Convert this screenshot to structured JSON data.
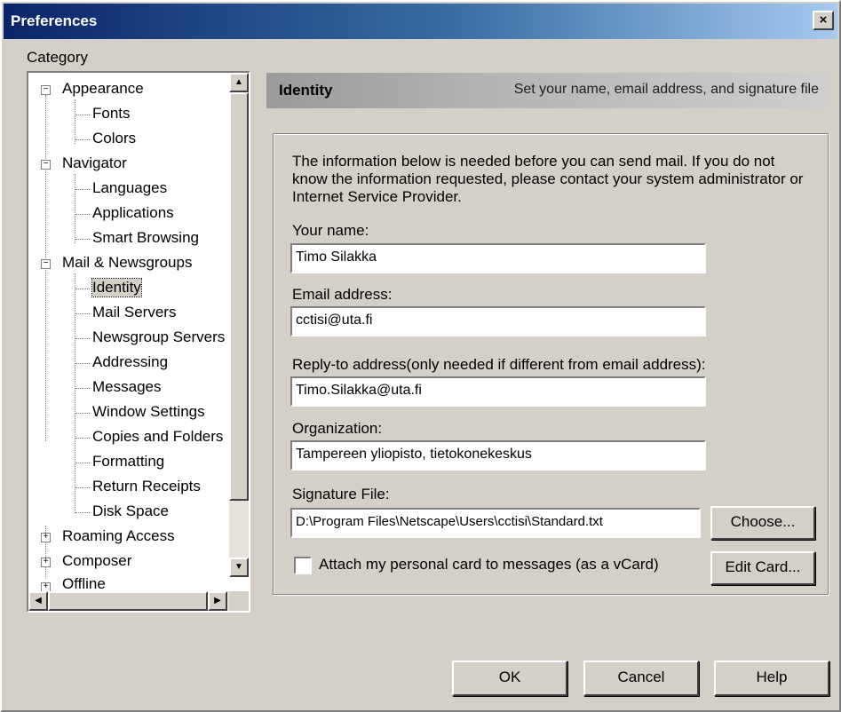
{
  "window": {
    "title": "Preferences",
    "close_label": "×"
  },
  "category_label": "Category",
  "tree": {
    "items": [
      {
        "label": "Appearance",
        "expander": "−"
      },
      {
        "label": "Fonts"
      },
      {
        "label": "Colors"
      },
      {
        "label": "Navigator",
        "expander": "−"
      },
      {
        "label": "Languages"
      },
      {
        "label": "Applications"
      },
      {
        "label": "Smart Browsing"
      },
      {
        "label": "Mail & Newsgroups",
        "expander": "−"
      },
      {
        "label": "Identity"
      },
      {
        "label": "Mail Servers"
      },
      {
        "label": "Newsgroup Servers"
      },
      {
        "label": "Addressing"
      },
      {
        "label": "Messages"
      },
      {
        "label": "Window Settings"
      },
      {
        "label": "Copies and Folders"
      },
      {
        "label": "Formatting"
      },
      {
        "label": "Return Receipts"
      },
      {
        "label": "Disk Space"
      },
      {
        "label": "Roaming Access",
        "expander": "+"
      },
      {
        "label": "Composer",
        "expander": "+"
      },
      {
        "label": "Offline",
        "expander": "+"
      }
    ],
    "scroll_up": "▲",
    "scroll_down": "▼",
    "scroll_left": "◀",
    "scroll_right": "▶"
  },
  "panel": {
    "title": "Identity",
    "description": "Set your name, email address, and signature file"
  },
  "info_text": "The information below is needed before you can send mail. If you do not know the information requested, please contact your system administrator or Internet Service Provider.",
  "fields": {
    "name_label": "Your name:",
    "name_value": "Timo Silakka",
    "email_label": "Email address:",
    "email_value": "cctisi@uta.fi",
    "reply_label": "Reply-to address(only needed if different from email address):",
    "reply_value": "Timo.Silakka@uta.fi",
    "org_label": "Organization:",
    "org_value": "Tampereen yliopisto, tietokonekeskus",
    "sig_label": "Signature File:",
    "sig_value": "D:\\Program Files\\Netscape\\Users\\cctisi\\Standard.txt"
  },
  "buttons": {
    "choose": "Choose...",
    "edit_card": "Edit Card...",
    "ok": "OK",
    "cancel": "Cancel",
    "help": "Help"
  },
  "attach_card_label": "Attach my personal card to messages (as a vCard)"
}
